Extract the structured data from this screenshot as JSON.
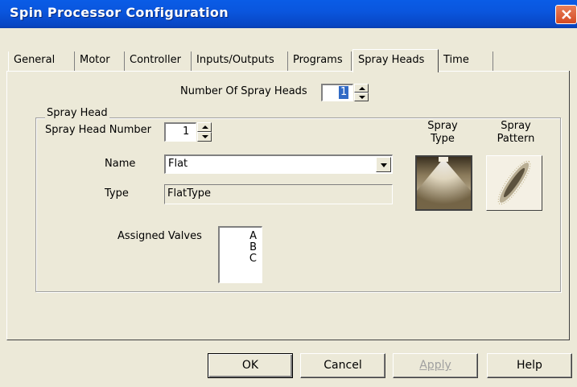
{
  "window": {
    "title": "Spin Processor Configuration"
  },
  "tabs": [
    {
      "label": "General"
    },
    {
      "label": "Motor"
    },
    {
      "label": "Controller"
    },
    {
      "label": "Inputs/Outputs"
    },
    {
      "label": "Programs"
    },
    {
      "label": "Spray Heads",
      "active": true
    },
    {
      "label": "Time"
    }
  ],
  "spray_heads": {
    "count_label": "Number Of Spray Heads",
    "count_value": "1",
    "group_label": "Spray Head",
    "number_label": "Spray Head Number",
    "number_value": "1",
    "name_label": "Name",
    "name_value": "Flat",
    "type_label": "Type",
    "type_value": "FlatType",
    "valves_label": "Assigned Valves",
    "valves": [
      "A",
      "B",
      "C"
    ],
    "spray_type_label": "Spray\nType",
    "spray_type_line1": "Spray",
    "spray_type_line2": "Type",
    "spray_pattern_line1": "Spray",
    "spray_pattern_line2": "Pattern"
  },
  "buttons": {
    "ok": "OK",
    "cancel": "Cancel",
    "apply": "Apply",
    "help": "Help"
  },
  "colors": {
    "titlebar": "#0a56de",
    "dialog_bg": "#ece9d8",
    "close": "#d44a22"
  }
}
